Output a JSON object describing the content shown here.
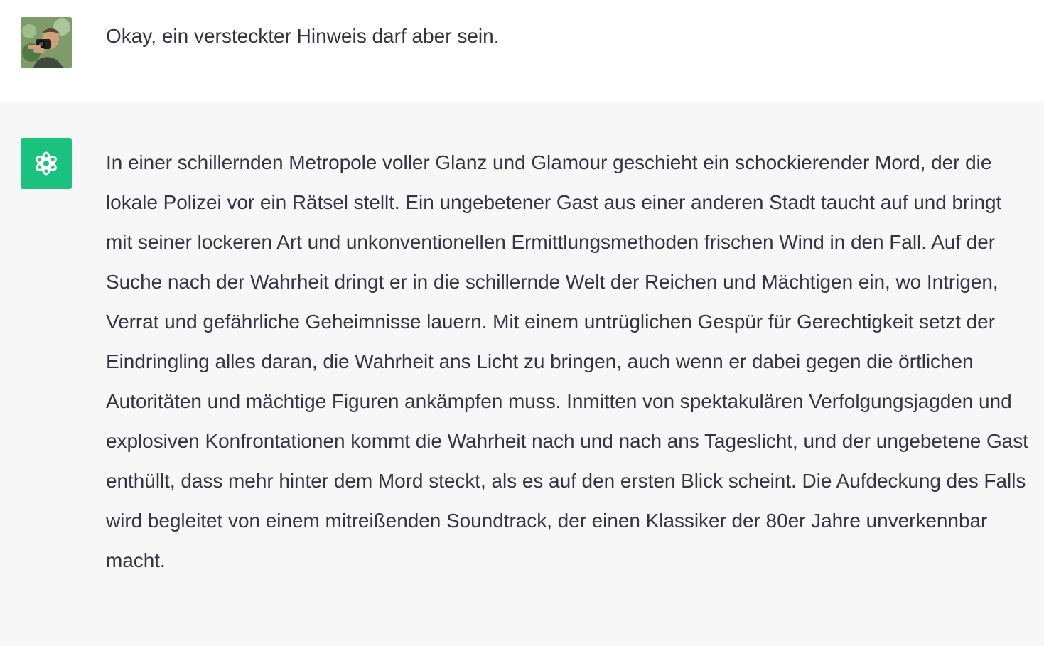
{
  "conversation": {
    "user_message": {
      "text": "Okay, ein versteckter Hinweis darf aber sein.",
      "avatar_icon": "user-photo-avatar"
    },
    "assistant_message": {
      "text": "In einer schillernden Metropole voller Glanz und Glamour geschieht ein schockierender Mord, der die lokale Polizei vor ein Rätsel stellt. Ein ungebetener Gast aus einer anderen Stadt taucht auf und bringt mit seiner lockeren Art und unkonventionellen Ermittlungsmethoden frischen Wind in den Fall. Auf der Suche nach der Wahrheit dringt er in die schillernde Welt der Reichen und Mächtigen ein, wo Intrigen, Verrat und gefährliche Geheimnisse lauern. Mit einem untrüglichen Gespür für Gerechtigkeit setzt der Eindringling alles daran, die Wahrheit ans Licht zu bringen, auch wenn er dabei gegen die örtlichen Autoritäten und mächtige Figuren ankämpfen muss. Inmitten von spektakulären Verfolgungsjagden und explosiven Konfrontationen kommt die Wahrheit nach und nach ans Tageslicht, und der ungebetene Gast enthüllt, dass mehr hinter dem Mord steckt, als es auf den ersten Blick scheint. Die Aufdeckung des Falls wird begleitet von einem mitreißenden Soundtrack, der einen Klassiker der 80er Jahre unverkennbar macht.",
      "avatar_icon": "openai-logo-icon"
    }
  },
  "colors": {
    "user_row_bg": "#ffffff",
    "assistant_row_bg": "#f7f7f8",
    "text": "#343541",
    "assistant_avatar_bg": "#19c37d"
  }
}
